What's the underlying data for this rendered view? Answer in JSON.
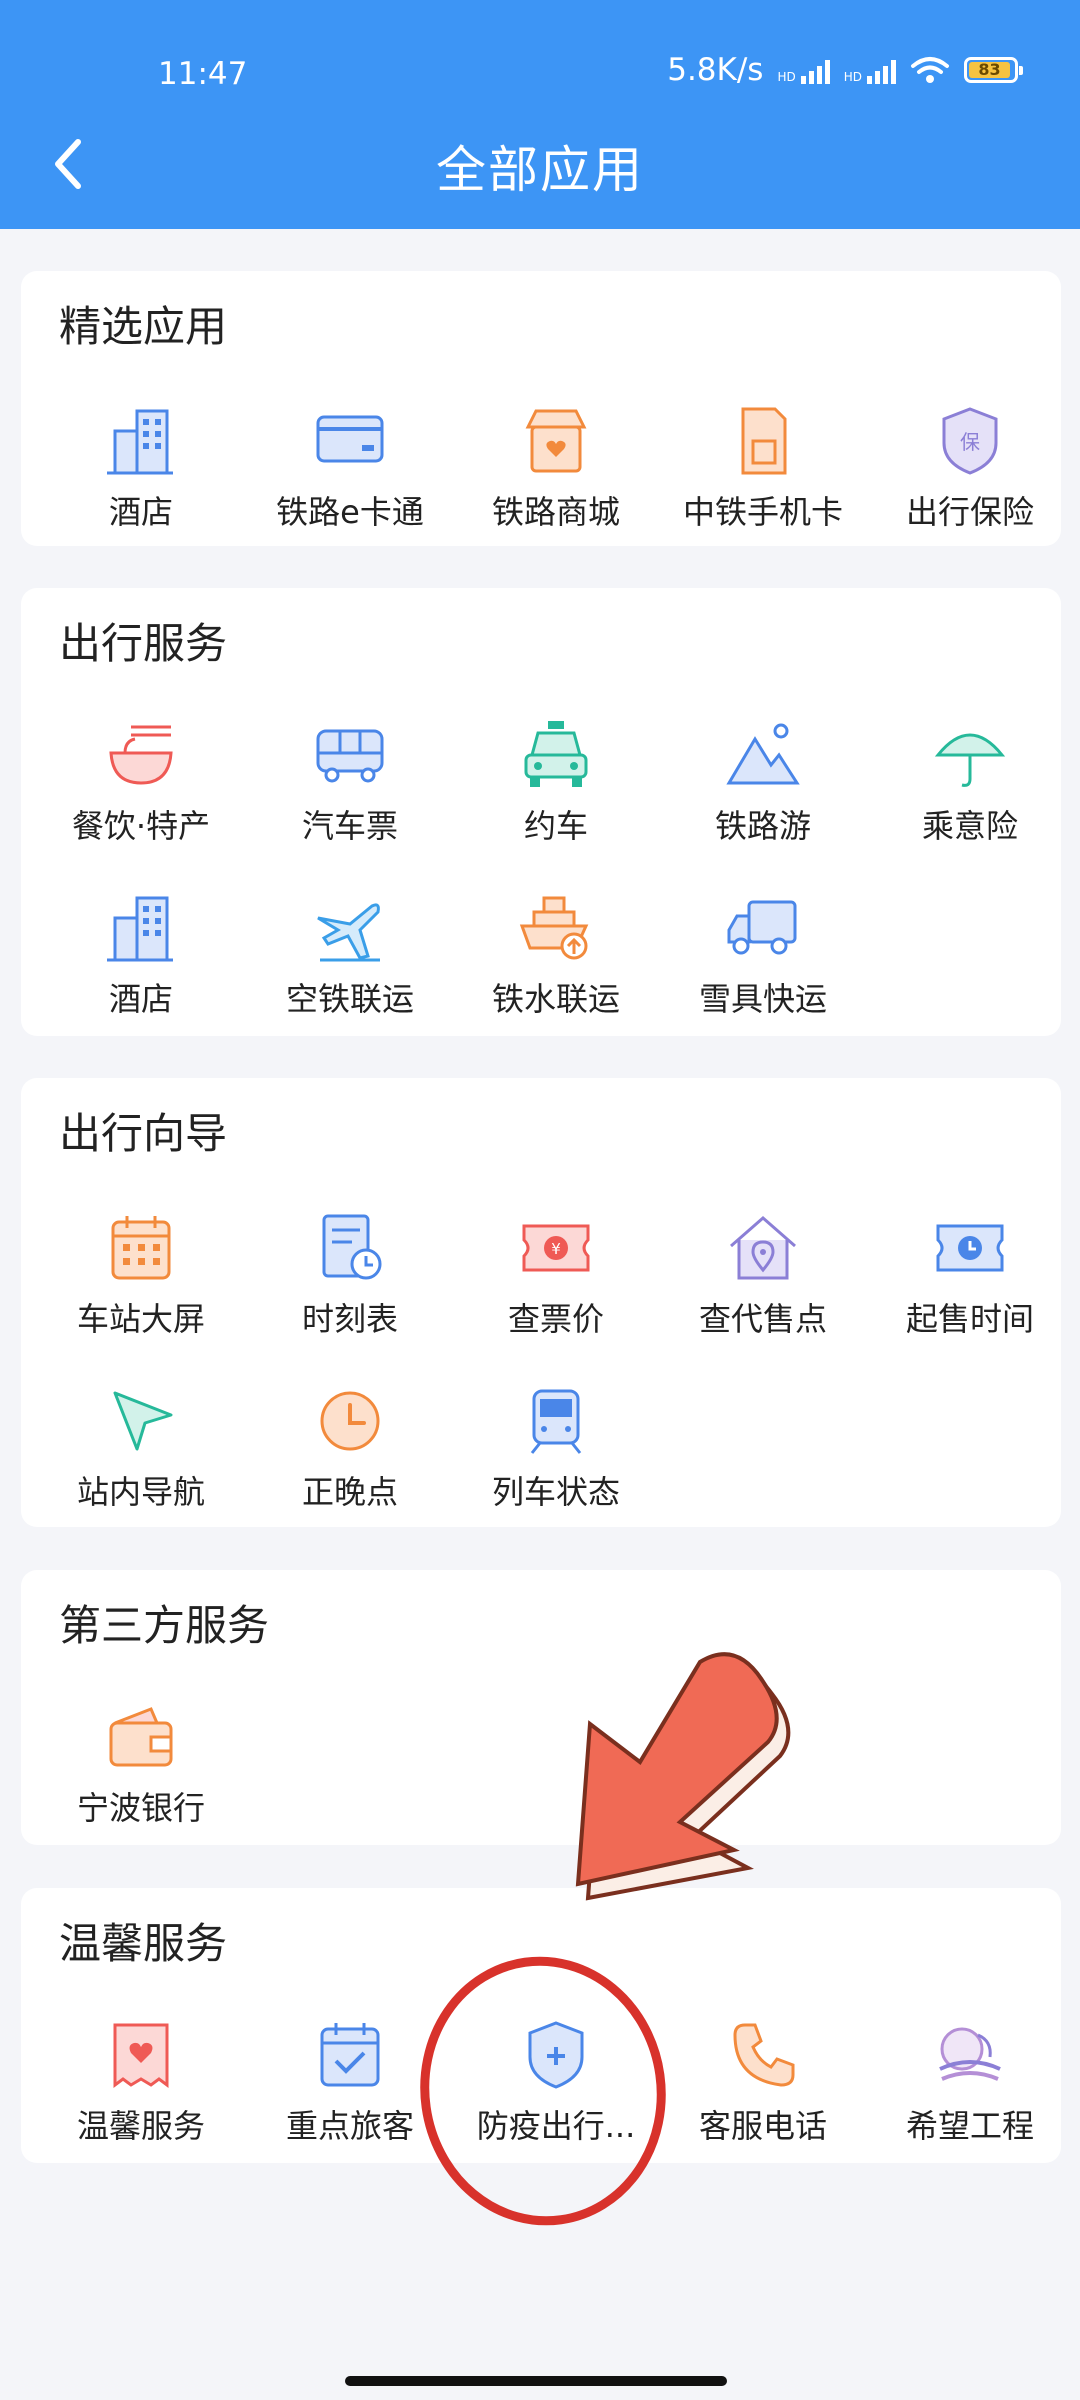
{
  "status_bar": {
    "time": "11:47",
    "speed": "5.8K/s",
    "hd": "HD",
    "battery": "83"
  },
  "header": {
    "title": "全部应用"
  },
  "sections": [
    {
      "title": "精选应用",
      "items": [
        {
          "label": "酒店",
          "icon": "building-icon"
        },
        {
          "label": "铁路e卡通",
          "icon": "card-icon"
        },
        {
          "label": "铁路商城",
          "icon": "shop-icon"
        },
        {
          "label": "中铁手机卡",
          "icon": "sim-card-icon"
        },
        {
          "label": "出行保险",
          "icon": "insurance-shield-icon"
        }
      ]
    },
    {
      "title": "出行服务",
      "items": [
        {
          "label": "餐饮·特产",
          "icon": "noodle-bowl-icon"
        },
        {
          "label": "汽车票",
          "icon": "bus-icon"
        },
        {
          "label": "约车",
          "icon": "taxi-icon"
        },
        {
          "label": "铁路游",
          "icon": "mountain-icon"
        },
        {
          "label": "乘意险",
          "icon": "umbrella-icon"
        },
        {
          "label": "酒店",
          "icon": "building-icon"
        },
        {
          "label": "空铁联运",
          "icon": "plane-train-icon"
        },
        {
          "label": "铁水联运",
          "icon": "ship-icon"
        },
        {
          "label": "雪具快运",
          "icon": "truck-icon"
        }
      ]
    },
    {
      "title": "出行向导",
      "items": [
        {
          "label": "车站大屏",
          "icon": "calendar-grid-icon"
        },
        {
          "label": "时刻表",
          "icon": "timetable-icon"
        },
        {
          "label": "查票价",
          "icon": "ticket-price-icon"
        },
        {
          "label": "查代售点",
          "icon": "house-pin-icon"
        },
        {
          "label": "起售时间",
          "icon": "ticket-clock-icon"
        },
        {
          "label": "站内导航",
          "icon": "navigation-arrow-icon"
        },
        {
          "label": "正晚点",
          "icon": "clock-icon"
        },
        {
          "label": "列车状态",
          "icon": "train-icon"
        }
      ]
    },
    {
      "title": "第三方服务",
      "items": [
        {
          "label": "宁波银行",
          "icon": "wallet-icon"
        }
      ]
    },
    {
      "title": "温馨服务",
      "items": [
        {
          "label": "温馨服务",
          "icon": "heart-ticket-icon"
        },
        {
          "label": "重点旅客",
          "icon": "calendar-check-icon"
        },
        {
          "label": "防疫出行...",
          "icon": "shield-plus-icon"
        },
        {
          "label": "客服电话",
          "icon": "phone-icon"
        },
        {
          "label": "希望工程",
          "icon": "hope-logo-icon"
        }
      ]
    }
  ],
  "colors": {
    "header": "#3d95f5",
    "blue": "#4a86e8",
    "orange": "#f28a3c",
    "red": "#ef5a55",
    "green": "#26b99a",
    "purple": "#8b7fd6",
    "arrow": "#f06a55",
    "circle": "#d8322b"
  }
}
